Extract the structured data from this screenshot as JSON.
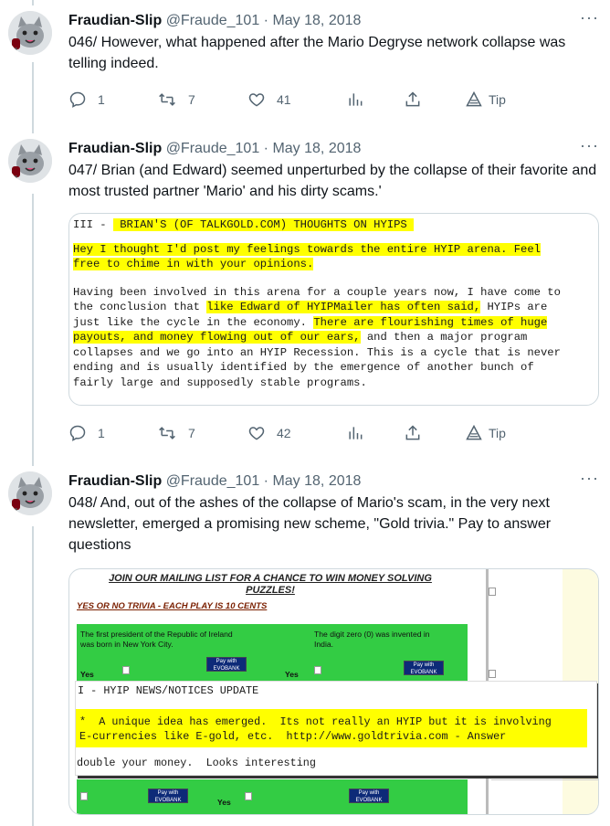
{
  "tweets": [
    {
      "author": "Fraudian-Slip",
      "handle": "@Fraude_101",
      "separator": "·",
      "date": "May 18, 2018",
      "more": "···",
      "text": "046/ However, what happened after the Mario Degryse network collapse was telling indeed.",
      "replies": "1",
      "retweets": "7",
      "likes": "41",
      "tip": "Tip"
    },
    {
      "author": "Fraudian-Slip",
      "handle": "@Fraude_101",
      "separator": "·",
      "date": "May 18, 2018",
      "more": "···",
      "text": "047/ Brian (and Edward) seemed unperturbed by the collapse of their favorite and most trusted partner 'Mario' and his dirty scams.'",
      "replies": "1",
      "retweets": "7",
      "likes": "42",
      "tip": "Tip"
    },
    {
      "author": "Fraudian-Slip",
      "handle": "@Fraude_101",
      "separator": "·",
      "date": "May 18, 2018",
      "more": "···",
      "text": "048/ And, out of the ashes of the collapse of Mario's scam, in the very next newsletter, emerged a promising new scheme, \"Gold trivia.\" Pay to answer questions"
    }
  ],
  "media1": {
    "l1a": "III - ",
    "l1b": " BRIAN'S (OF TALKGOLD.COM) THOUGHTS ON HYIPS ",
    "p1_line1": "Hey I thought I'd post my feelings towards the entire HYIP arena. Feel",
    "p1_line2": "free to chime in with your opinions.",
    "p2_line1": "Having been involved in this arena for a couple years now, I have come to",
    "p2_line2a": "the conclusion that ",
    "p2_line2b": "like Edward of HYIPMailer has often said,",
    "p2_line2c": " HYIPs are",
    "p2_line3a": "just like the cycle in the economy.",
    "p2_line3b": " ",
    "p2_line3c": "There are flourishing times of huge",
    "p2_line4a": "payouts, and money flowing out of our ears,",
    "p2_line4b": " and then a major program",
    "p2_line5": "collapses and we go into an HYIP Recession. This is a cycle that is never",
    "p2_line6": "ending and is usually identified by the emergence of another bunch of",
    "p2_line7": "fairly large and supposedly stable programs."
  },
  "media2": {
    "heading_line1": "JOIN OUR MAILING LIST FOR A CHANCE TO WIN MONEY SOLVING",
    "heading_line2": "PUZZLES!",
    "subheading": "YES OR NO TRIVIA - EACH PLAY IS 10 CENTS",
    "q1_line1": "The first president of the Republic of Ireland",
    "q1_line2": "was born in New York City.",
    "q2_line1": "The digit zero (0) was invented in",
    "q2_line2": "India.",
    "yes": "Yes",
    "evo_label": "Pay with EVOBANK",
    "overlay_title": "I - HYIP NEWS/NOTICES UPDATE",
    "overlay_line1": "*  A unique idea has emerged.  Its not really an HYIP but it is involving",
    "overlay_line2": "E-currencies like E-gold, etc.  http://www.goldtrivia.com - Answer",
    "overlay_line3": "double your money.  Looks interesting"
  },
  "colors": {
    "text": "#0f1419",
    "muted": "#536471",
    "highlight": "#ffff00",
    "trivia_green": "#33cc44"
  }
}
